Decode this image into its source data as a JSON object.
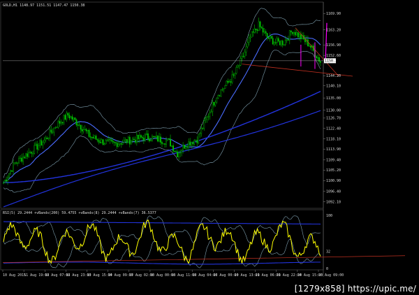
{
  "chart_data": {
    "type": "candlestick",
    "main_header": "GOLD,H1  1148.97 1151.51 1147.47 1150.38",
    "main_axis_ticks": [
      "1169.90",
      "1163.20",
      "1156.90",
      "1152.60",
      "1150.38",
      "1144.20",
      "1140.10",
      "1135.00",
      "1130.00",
      "1126.70",
      "1122.40",
      "1118.10",
      "1113.90",
      "1109.40",
      "1105.20",
      "1100.90",
      "1096.40",
      "1092.10"
    ],
    "current_price": "1150.38",
    "main_ylim": [
      1090,
      1172
    ],
    "indicator_header": "RSI(5) 29.2444  +vBands(200) 59.4755  +vBands(8) 29.2444  +vBands(7) 36.5377",
    "indicator_ticks": [
      "100",
      "32",
      "0"
    ],
    "indicator_ylim": [
      0,
      100
    ],
    "x_ticks": [
      "10 Aug 2015",
      "11 Aug 19:00",
      "12 Aug 07:00",
      "12 Aug 23:00",
      "13 Aug 15:00",
      "14 Aug 09:00",
      "17 Aug 02:00",
      "18 Aug 00:00",
      "18 Aug 11:00",
      "19 Aug 04:00",
      "20 Aug 00:00",
      "20 Aug 13:00",
      "21 Aug 06:00",
      "21 Aug 22:00",
      "24 Aug 15:00",
      "25 Aug 09:00"
    ],
    "colors": {
      "bull": "#00c000",
      "bear": "#00c000",
      "ma_fast": "#4a6cff",
      "ma_slow": "#2233dd",
      "bands": "#7fa0b0",
      "rsi": "#ffff00",
      "trendline": "#c03020",
      "magenta": "#ff00ff",
      "grid": "#3a3a3a"
    },
    "grid": false,
    "legend": "none"
  },
  "watermark": "[1279x858] https://upic.me/"
}
